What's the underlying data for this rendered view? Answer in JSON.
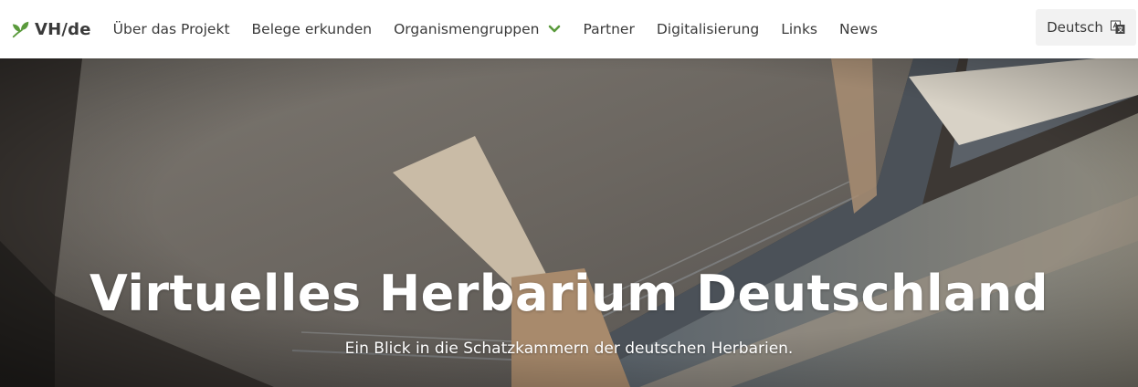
{
  "brand": {
    "text": "VH/de",
    "icon": "leaf-icon",
    "accent_color": "#5a9a3c"
  },
  "nav": {
    "items": [
      {
        "label": "Über das Projekt"
      },
      {
        "label": "Belege erkunden"
      },
      {
        "label": "Organismengruppen",
        "icon": "chevron-down-icon"
      },
      {
        "label": "Partner"
      },
      {
        "label": "Digitalisierung"
      },
      {
        "label": "Links"
      },
      {
        "label": "News"
      }
    ]
  },
  "language": {
    "label": "Deutsch",
    "icon": "translate-icon"
  },
  "hero": {
    "title": "Virtuelles Herbarium Deutschland",
    "subtitle": "Ein Blick in die Schatzkammern der deutschen Herbarien."
  }
}
